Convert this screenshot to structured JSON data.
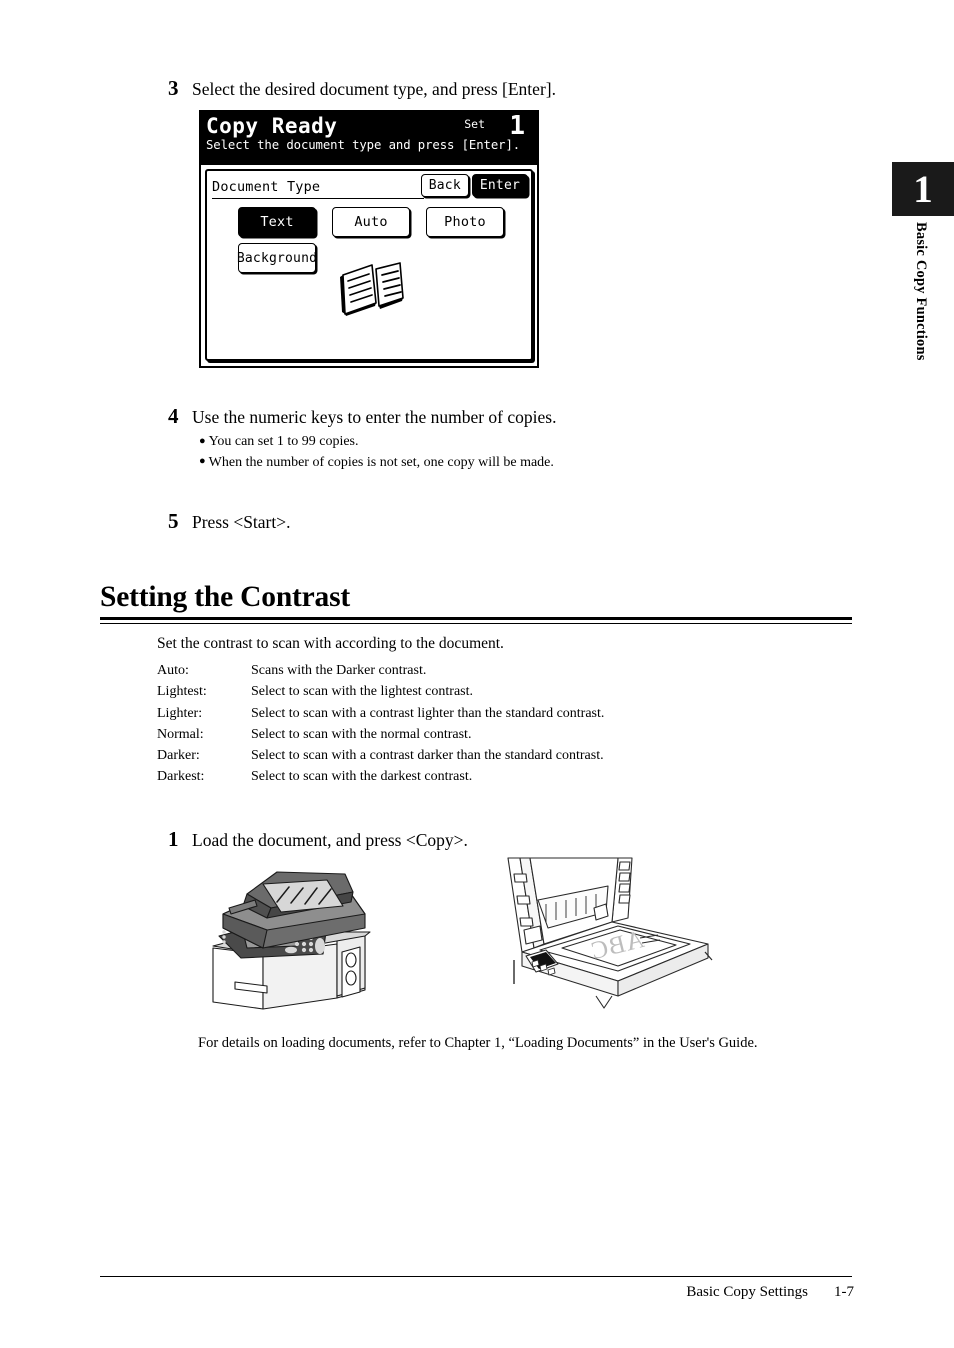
{
  "sidebar_tab": {
    "chapter_number": "1",
    "chapter_title": "Basic Copy Functions"
  },
  "steps": [
    {
      "number": "3",
      "text": "Select the desired document type, and press [Enter]."
    },
    {
      "number": "4",
      "text": "Use the numeric keys to enter the number of copies."
    },
    {
      "number": "5",
      "text": "Press <Start>."
    },
    {
      "number": "1",
      "text": "Load the document, and press <Copy>."
    }
  ],
  "step4_bullets": [
    "You can set 1 to 99 copies.",
    "When the number of copies is not set, one copy will be made."
  ],
  "lcd": {
    "title": "Copy Ready",
    "subtitle": "Select the document type and press [Enter].",
    "set_label": "Set",
    "set_value": "1",
    "panel_label": "Document Type",
    "header_buttons": [
      {
        "label": "Back",
        "selected": false
      },
      {
        "label": "Enter",
        "selected": true
      }
    ],
    "type_buttons": [
      {
        "label": "Text",
        "selected": true
      },
      {
        "label": "Auto",
        "selected": false
      },
      {
        "label": "Photo",
        "selected": false
      }
    ],
    "type_buttons_row2": [
      {
        "label": "Background",
        "selected": false
      }
    ],
    "icon": "document-stack-icon"
  },
  "section": {
    "heading": "Setting the Contrast",
    "intro": "Set the contrast to scan with according to the document.",
    "definitions": [
      {
        "term": "Auto:",
        "description": "Scans with the Darker contrast."
      },
      {
        "term": "Lightest:",
        "description": "Select to scan with the lightest contrast."
      },
      {
        "term": "Lighter:",
        "description": "Select to scan with a contrast lighter than the standard contrast."
      },
      {
        "term": "Normal:",
        "description": "Select to scan with the normal contrast."
      },
      {
        "term": "Darker:",
        "description": "Select to scan with a contrast darker than the standard contrast."
      },
      {
        "term": "Darkest:",
        "description": "Select to scan with the darkest contrast."
      }
    ]
  },
  "note": "For details on loading documents, refer to Chapter 1, “Loading Documents” in the User's Guide.",
  "illustrations": {
    "mfp": "multifunction-printer-with-adf-illustration",
    "platen": "open-platen-with-document-illustration",
    "platen_document_text": "ABC"
  },
  "footer": {
    "title": "Basic Copy Settings",
    "page": "1-7"
  }
}
